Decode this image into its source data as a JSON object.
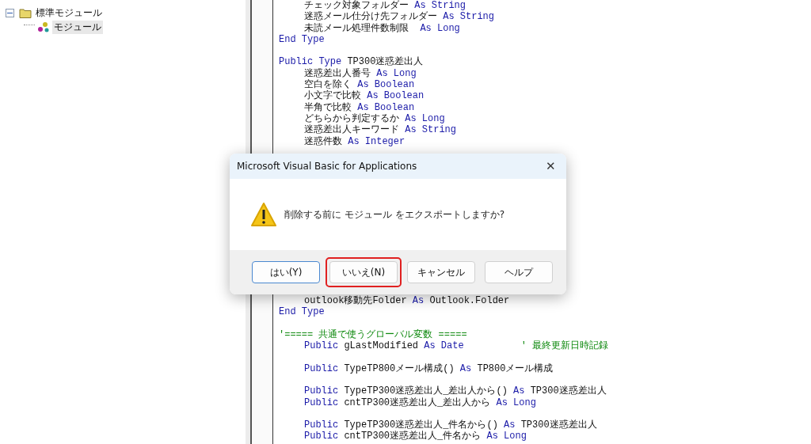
{
  "project_tree": {
    "items": [
      {
        "label": "標準モジュール",
        "kind": "folder",
        "expanded": true,
        "selected": false,
        "children": [
          {
            "label": "モジュール",
            "kind": "module",
            "selected": true
          }
        ]
      }
    ]
  },
  "code_top": [
    {
      "indented": true,
      "space_before": false,
      "segments": [
        {
          "kind": "plain",
          "text": "チェック対象フォルダー "
        },
        {
          "kind": "keyword",
          "text": "As String"
        }
      ]
    },
    {
      "indented": true,
      "space_before": false,
      "segments": [
        {
          "kind": "plain",
          "text": "迷惑メール仕分け先フォルダー "
        },
        {
          "kind": "keyword",
          "text": "As String"
        }
      ]
    },
    {
      "indented": true,
      "space_before": false,
      "segments": [
        {
          "kind": "plain",
          "text": "未読メール処理件数制限  "
        },
        {
          "kind": "keyword",
          "text": "As Long"
        }
      ]
    },
    {
      "indented": false,
      "space_before": false,
      "segments": [
        {
          "kind": "keyword",
          "text": "End Type"
        }
      ]
    },
    {
      "indented": false,
      "space_before": true,
      "segments": [
        {
          "kind": "keyword",
          "text": "Public Type "
        },
        {
          "kind": "plain",
          "text": "TP300迷惑差出人"
        }
      ]
    },
    {
      "indented": true,
      "space_before": false,
      "segments": [
        {
          "kind": "plain",
          "text": "迷惑差出人番号 "
        },
        {
          "kind": "keyword",
          "text": "As Long"
        }
      ]
    },
    {
      "indented": true,
      "space_before": false,
      "segments": [
        {
          "kind": "plain",
          "text": "空白を除く "
        },
        {
          "kind": "keyword",
          "text": "As Boolean"
        }
      ]
    },
    {
      "indented": true,
      "space_before": false,
      "segments": [
        {
          "kind": "plain",
          "text": "小文字で比較 "
        },
        {
          "kind": "keyword",
          "text": "As Boolean"
        }
      ]
    },
    {
      "indented": true,
      "space_before": false,
      "segments": [
        {
          "kind": "plain",
          "text": "半角で比較 "
        },
        {
          "kind": "keyword",
          "text": "As Boolean"
        }
      ]
    },
    {
      "indented": true,
      "space_before": false,
      "segments": [
        {
          "kind": "plain",
          "text": "どちらから判定するか "
        },
        {
          "kind": "keyword",
          "text": "As Long"
        }
      ]
    },
    {
      "indented": true,
      "space_before": false,
      "segments": [
        {
          "kind": "plain",
          "text": "迷惑差出人キーワード "
        },
        {
          "kind": "keyword",
          "text": "As String"
        }
      ]
    },
    {
      "indented": true,
      "space_before": false,
      "segments": [
        {
          "kind": "plain",
          "text": "迷惑件数 "
        },
        {
          "kind": "keyword",
          "text": "As Integer"
        }
      ]
    }
  ],
  "code_bottom": [
    {
      "indented": true,
      "space_before": false,
      "segments": [
        {
          "kind": "plain",
          "text": "outlook移動先Folder "
        },
        {
          "kind": "keyword",
          "text": "As"
        },
        {
          "kind": "plain",
          "text": " Outlook.Folder"
        }
      ]
    },
    {
      "indented": false,
      "space_before": false,
      "segments": [
        {
          "kind": "keyword",
          "text": "End Type"
        }
      ]
    },
    {
      "indented": false,
      "space_before": true,
      "segments": [
        {
          "kind": "comment",
          "text": "'===== 共通で使うグローバル変数 ====="
        }
      ]
    },
    {
      "indented": true,
      "space_before": false,
      "segments": [
        {
          "kind": "keyword",
          "text": "Public "
        },
        {
          "kind": "plain",
          "text": "gLastModified "
        },
        {
          "kind": "keyword",
          "text": "As Date"
        },
        {
          "kind": "comment",
          "text": "          ' 最終更新日時記録"
        }
      ]
    },
    {
      "indented": true,
      "space_before": true,
      "segments": [
        {
          "kind": "keyword",
          "text": "Public "
        },
        {
          "kind": "plain",
          "text": "TypeTP800メール構成() "
        },
        {
          "kind": "keyword",
          "text": "As "
        },
        {
          "kind": "plain",
          "text": "TP800メール構成"
        }
      ]
    },
    {
      "indented": true,
      "space_before": true,
      "segments": [
        {
          "kind": "keyword",
          "text": "Public "
        },
        {
          "kind": "plain",
          "text": "TypeTP300迷惑差出人_差出人から() "
        },
        {
          "kind": "keyword",
          "text": "As "
        },
        {
          "kind": "plain",
          "text": "TP300迷惑差出人"
        }
      ]
    },
    {
      "indented": true,
      "space_before": false,
      "segments": [
        {
          "kind": "keyword",
          "text": "Public "
        },
        {
          "kind": "plain",
          "text": "cntTP300迷惑差出人_差出人から "
        },
        {
          "kind": "keyword",
          "text": "As Long"
        }
      ]
    },
    {
      "indented": true,
      "space_before": true,
      "segments": [
        {
          "kind": "keyword",
          "text": "Public "
        },
        {
          "kind": "plain",
          "text": "TypeTP300迷惑差出人_件名から() "
        },
        {
          "kind": "keyword",
          "text": "As "
        },
        {
          "kind": "plain",
          "text": "TP300迷惑差出人"
        }
      ]
    },
    {
      "indented": true,
      "space_before": false,
      "segments": [
        {
          "kind": "keyword",
          "text": "Public "
        },
        {
          "kind": "plain",
          "text": "cntTP300迷惑差出人_件名から "
        },
        {
          "kind": "keyword",
          "text": "As Long"
        }
      ]
    }
  ],
  "dialog": {
    "title": "Microsoft Visual Basic for Applications",
    "close": "✕",
    "message": "削除する前に モジュール をエクスポートしますか?",
    "buttons": [
      {
        "label": "はい(Y)",
        "default": true,
        "highlighted": false
      },
      {
        "label": "いいえ(N)",
        "default": false,
        "highlighted": true
      },
      {
        "label": "キャンセル",
        "default": false,
        "highlighted": false
      },
      {
        "label": "ヘルプ",
        "default": false,
        "highlighted": false
      }
    ]
  }
}
